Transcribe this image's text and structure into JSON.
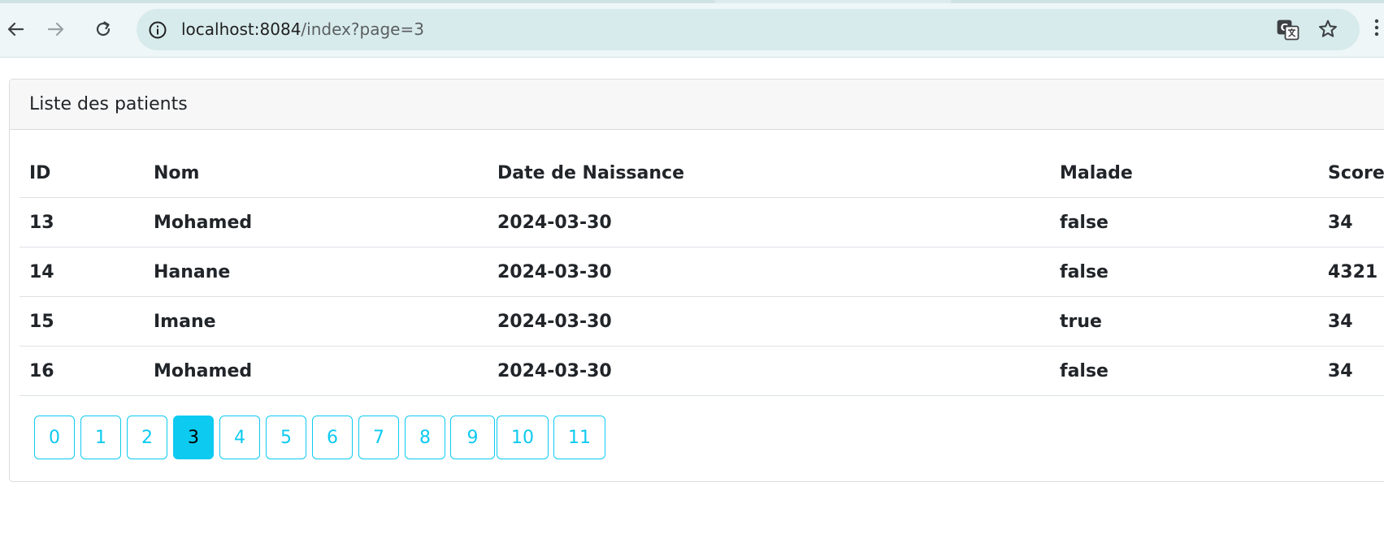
{
  "browser": {
    "url_host": "localhost:8084",
    "url_path": "/index?page=3",
    "icons": {
      "back": "back-arrow-icon",
      "forward": "forward-arrow-icon",
      "reload": "reload-icon",
      "info": "site-info-icon",
      "translate": "translate-icon",
      "bookmark": "star-icon",
      "menu": "menu-dots-icon"
    }
  },
  "card": {
    "title": "Liste des patients"
  },
  "table": {
    "columns": [
      "ID",
      "Nom",
      "Date de Naissance",
      "Malade",
      "Score"
    ],
    "rows": [
      [
        "13",
        "Mohamed",
        "2024-03-30",
        "false",
        "34"
      ],
      [
        "14",
        "Hanane",
        "2024-03-30",
        "false",
        "4321"
      ],
      [
        "15",
        "Imane",
        "2024-03-30",
        "true",
        "34"
      ],
      [
        "16",
        "Mohamed",
        "2024-03-30",
        "false",
        "34"
      ]
    ]
  },
  "pagination": {
    "pages": [
      "0",
      "1",
      "2",
      "3",
      "4",
      "5",
      "6",
      "7",
      "8",
      "9",
      "10",
      "11"
    ],
    "active": "3"
  },
  "colors": {
    "accent": "#0dcaf0",
    "text": "#212529",
    "header_bg": "#f7f7f7",
    "toolbar_bg": "#eef6f7",
    "omnibox_bg": "#d8ebec"
  }
}
